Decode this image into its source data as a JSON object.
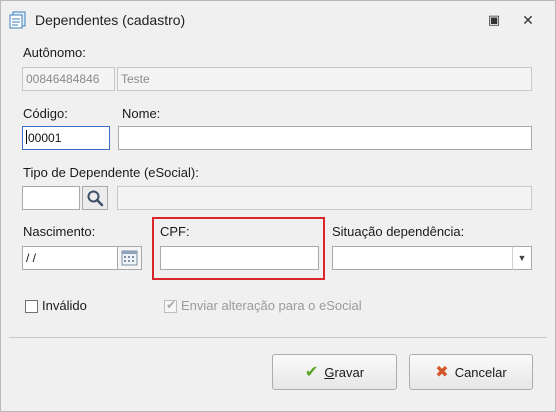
{
  "window": {
    "title": "Dependentes (cadastro)",
    "icon": "form-icon",
    "restore_glyph": "▣",
    "close_glyph": "✕"
  },
  "autonomo": {
    "label": "Autônomo:",
    "codigo_value": "00846484846",
    "nome_value": "Teste"
  },
  "codigo": {
    "label": "Código:",
    "value": "00001"
  },
  "nome": {
    "label": "Nome:",
    "value": ""
  },
  "tipo_dependente": {
    "label": "Tipo de Dependente (eSocial):",
    "value": "",
    "description": ""
  },
  "nascimento": {
    "label": "Nascimento:",
    "value": " /  /"
  },
  "cpf": {
    "label": "CPF:",
    "value": ""
  },
  "situacao": {
    "label": "Situação dependência:",
    "value": ""
  },
  "invalido": {
    "label": "Inválido",
    "checked": false
  },
  "enviar_esocial": {
    "label": "Enviar alteração para o eSocial",
    "checked": true,
    "enabled": false
  },
  "buttons": {
    "gravar_first": "G",
    "gravar_rest": "ravar",
    "cancelar": "Cancelar"
  },
  "colors": {
    "highlight": "#d9262c",
    "gravar_icon": "#5aa624",
    "cancelar_icon": "#d2572a"
  }
}
